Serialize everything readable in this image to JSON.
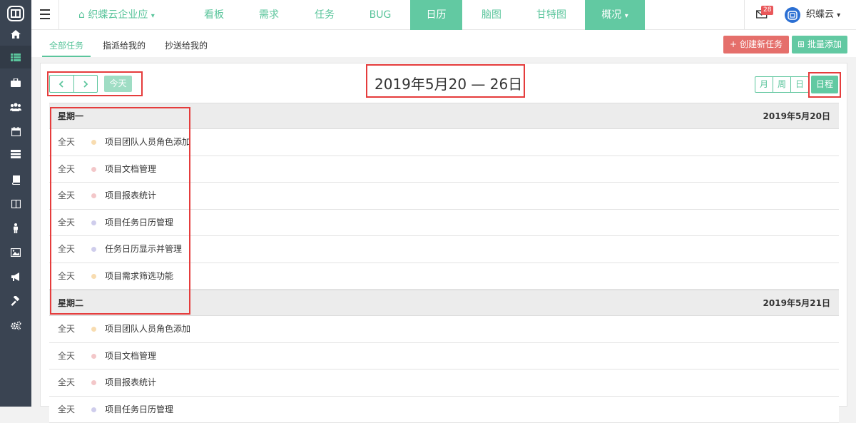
{
  "sidebar": {
    "icons": [
      "logo-icon",
      "home-icon",
      "list-icon",
      "briefcase-icon",
      "users-icon",
      "calendar-icon",
      "tasks-icon",
      "book-icon",
      "columns-icon",
      "person-icon",
      "image-icon",
      "bullhorn-icon",
      "gavel-icon",
      "settings-icon"
    ]
  },
  "topbar": {
    "project_name": "织蝶云企业应",
    "nav": [
      {
        "label": "看板"
      },
      {
        "label": "需求"
      },
      {
        "label": "任务"
      },
      {
        "label": "BUG"
      },
      {
        "label": "日历",
        "active": true
      },
      {
        "label": "脑图"
      },
      {
        "label": "甘特图"
      },
      {
        "label": "概况",
        "active": true
      }
    ],
    "mail_count": "28",
    "user_name": "织蝶云"
  },
  "subbar": {
    "tabs": [
      {
        "label": "全部任务",
        "active": true
      },
      {
        "label": "指派给我的"
      },
      {
        "label": "抄送给我的"
      }
    ],
    "create_label": "创建新任务",
    "batch_label": "批量添加"
  },
  "calendar": {
    "today_label": "今天",
    "title": "2019年5月20 — 26日",
    "views": [
      "月",
      "周",
      "日"
    ],
    "active_view": "日程",
    "days": [
      {
        "name": "星期一",
        "date": "2019年5月20日",
        "events": [
          {
            "time": "全天",
            "title": "项目团队人员角色添加",
            "color": "#f8dcb0"
          },
          {
            "time": "全天",
            "title": "项目文档管理",
            "color": "#f3c7c9"
          },
          {
            "time": "全天",
            "title": "项目报表统计",
            "color": "#f3c7c9"
          },
          {
            "time": "全天",
            "title": "项目任务日历管理",
            "color": "#cfcdec"
          },
          {
            "time": "全天",
            "title": "任务日历显示并管理",
            "color": "#cfcdec"
          },
          {
            "time": "全天",
            "title": "项目需求筛选功能",
            "color": "#f8dcb0"
          }
        ]
      },
      {
        "name": "星期二",
        "date": "2019年5月21日",
        "events": [
          {
            "time": "全天",
            "title": "项目团队人员角色添加",
            "color": "#f8dcb0"
          },
          {
            "time": "全天",
            "title": "项目文档管理",
            "color": "#f3c7c9"
          },
          {
            "time": "全天",
            "title": "项目报表统计",
            "color": "#f3c7c9"
          },
          {
            "time": "全天",
            "title": "项目任务日历管理",
            "color": "#cfcdec"
          }
        ]
      }
    ]
  },
  "colors": {
    "accent": "#5bc59c",
    "danger": "#e56f6b",
    "sidebar": "#3a4452"
  }
}
